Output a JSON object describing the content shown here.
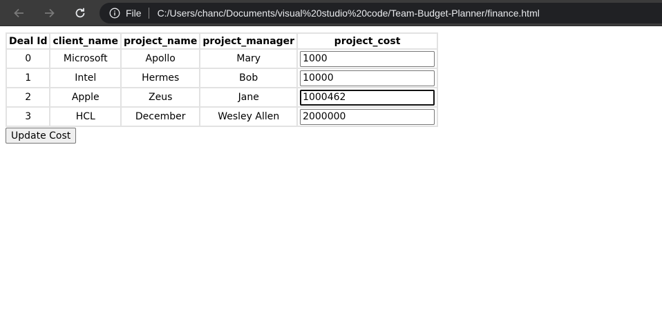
{
  "browser": {
    "back_icon": "arrow-left-icon",
    "forward_icon": "arrow-right-icon",
    "reload_icon": "reload-icon",
    "info_icon": "info-icon",
    "scheme_label": "File",
    "url": "C:/Users/chanc/Documents/visual%20studio%20code/Team-Budget-Planner/finance.html"
  },
  "table": {
    "headers": [
      "Deal Id",
      "client_name",
      "project_name",
      "project_manager",
      "project_cost"
    ],
    "rows": [
      {
        "deal_id": "0",
        "client_name": "Microsoft",
        "project_name": "Apollo",
        "project_manager": "Mary",
        "project_cost": "1000"
      },
      {
        "deal_id": "1",
        "client_name": "Intel",
        "project_name": "Hermes",
        "project_manager": "Bob",
        "project_cost": "10000"
      },
      {
        "deal_id": "2",
        "client_name": "Apple",
        "project_name": "Zeus",
        "project_manager": "Jane",
        "project_cost": "1000462"
      },
      {
        "deal_id": "3",
        "client_name": "HCL",
        "project_name": "December",
        "project_manager": "Wesley Allen",
        "project_cost": "2000000"
      }
    ]
  },
  "update_button_label": "Update Cost",
  "colors": {
    "toolbar": "#3b3b3b",
    "omnibox": "#202124",
    "table_border": "#e2e2e2"
  }
}
